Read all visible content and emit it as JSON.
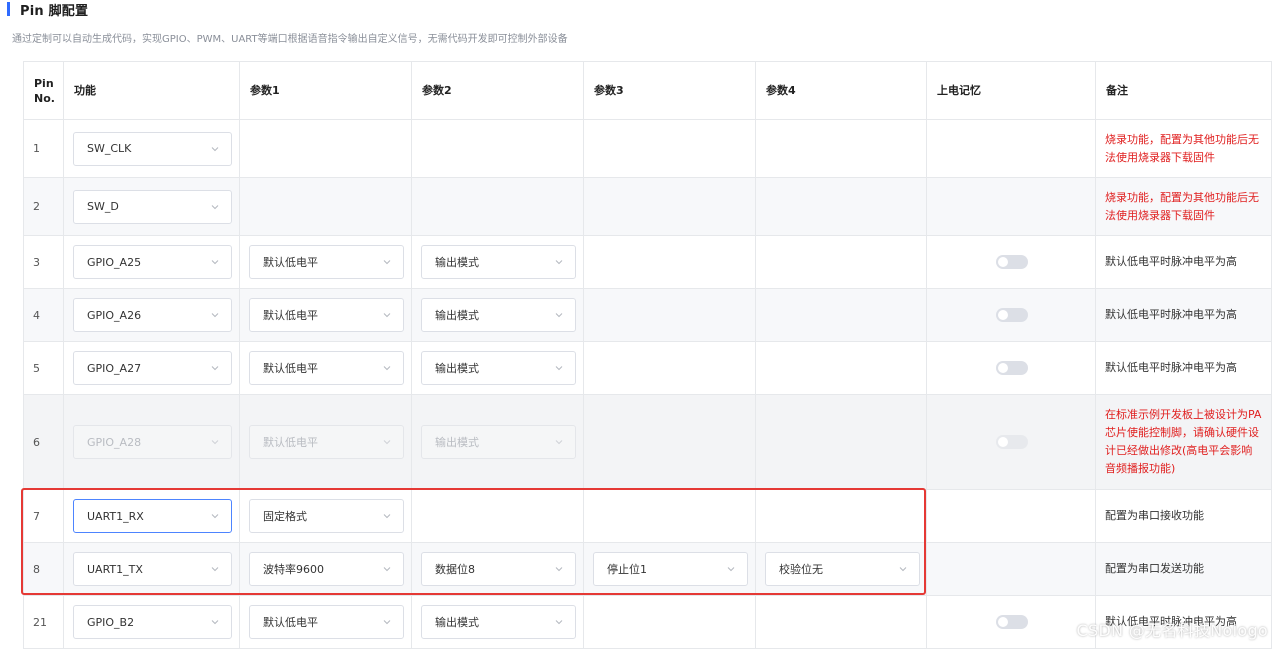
{
  "header": {
    "title": "Pin 脚配置",
    "subtitle": "通过定制可以自动生成代码，实现GPIO、PWM、UART等端口根据语音指令输出自定义信号，无需代码开发即可控制外部设备"
  },
  "table": {
    "columns": {
      "pin": "Pin No.",
      "func": "功能",
      "p1": "参数1",
      "p2": "参数2",
      "p3": "参数3",
      "p4": "参数4",
      "memory": "上电记忆",
      "note": "备注"
    },
    "rows": [
      {
        "pin": "1",
        "func": "SW_CLK",
        "p1": "",
        "p2": "",
        "p3": "",
        "p4": "",
        "note": "烧录功能，配置为其他功能后无法使用烧录器下载固件"
      },
      {
        "pin": "2",
        "func": "SW_D",
        "p1": "",
        "p2": "",
        "p3": "",
        "p4": "",
        "note": "烧录功能，配置为其他功能后无法使用烧录器下载固件"
      },
      {
        "pin": "3",
        "func": "GPIO_A25",
        "p1": "默认低电平",
        "p2": "输出模式",
        "p3": "",
        "p4": "",
        "note": "默认低电平时脉冲电平为高"
      },
      {
        "pin": "4",
        "func": "GPIO_A26",
        "p1": "默认低电平",
        "p2": "输出模式",
        "p3": "",
        "p4": "",
        "note": "默认低电平时脉冲电平为高"
      },
      {
        "pin": "5",
        "func": "GPIO_A27",
        "p1": "默认低电平",
        "p2": "输出模式",
        "p3": "",
        "p4": "",
        "note": "默认低电平时脉冲电平为高"
      },
      {
        "pin": "6",
        "func": "GPIO_A28",
        "p1": "默认低电平",
        "p2": "输出模式",
        "p3": "",
        "p4": "",
        "note": "在标准示例开发板上被设计为PA芯片使能控制脚，请确认硬件设计已经做出修改(高电平会影响音频播报功能)"
      },
      {
        "pin": "7",
        "func": "UART1_RX",
        "p1": "固定格式",
        "p2": "",
        "p3": "",
        "p4": "",
        "note": "配置为串口接收功能"
      },
      {
        "pin": "8",
        "func": "UART1_TX",
        "p1": "波特率9600",
        "p2": "数据位8",
        "p3": "停止位1",
        "p4": "校验位无",
        "note": "配置为串口发送功能"
      },
      {
        "pin": "21",
        "func": "GPIO_B2",
        "p1": "默认低电平",
        "p2": "输出模式",
        "p3": "",
        "p4": "",
        "note": "默认低电平时脉冲电平为高"
      }
    ]
  },
  "watermark": "CSDN @无名科技Nologo",
  "colors": {
    "accent": "#2f6bff",
    "warning_text": "#e02020",
    "highlight_box": "#e53935",
    "focused_border": "#4d84ff"
  }
}
